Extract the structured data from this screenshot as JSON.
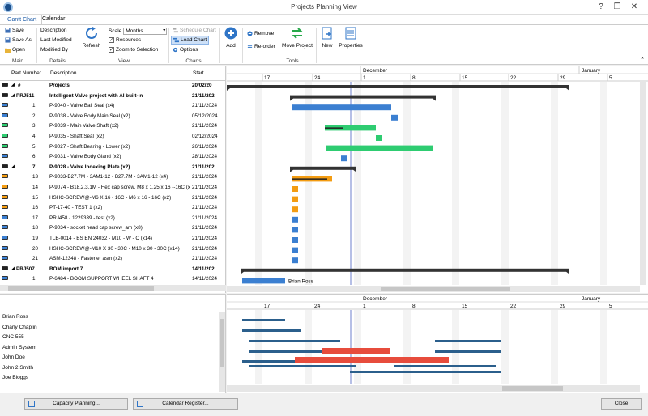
{
  "window": {
    "title": "Projects Planning View",
    "help": "?",
    "restore": "❐",
    "close": "✕"
  },
  "tabs": [
    {
      "label": "Gantt Chart"
    },
    {
      "label": "Calendar"
    }
  ],
  "ribbon": {
    "main": {
      "save": "Save",
      "save_as": "Save As",
      "open": "Open",
      "label": "Main"
    },
    "details": {
      "description": "Description",
      "last_modified": "Last Modified",
      "modified_by": "Modified By",
      "label": "Details"
    },
    "view": {
      "refresh": "Refresh",
      "scale_label": "Scale",
      "scale_value": "Months",
      "resources": "Resources",
      "zoom_to_selection": "Zoom to Selection",
      "label": "View"
    },
    "charts": {
      "schedule_chart": "Schedule Chart",
      "load_chart": "Load Chart",
      "options": "Options",
      "label": "Charts"
    },
    "tools": {
      "add": "Add",
      "remove": "Remove",
      "reorder": "Re-order",
      "move_project": "Move Project",
      "new": "New",
      "properties": "Properties",
      "label": "Tools"
    }
  },
  "grid": {
    "headers": {
      "part_number": "Part Number",
      "description": "Description",
      "start": "Start"
    },
    "rows": [
      {
        "num": "#",
        "desc": "Projects",
        "start": "20/02/20",
        "bold": true,
        "expander": "◢",
        "color": "#222"
      },
      {
        "num": "PRJ511",
        "desc": "Intelligent Valve project with AI built-in",
        "start": "21/11/202",
        "bold": true,
        "expander": "◢",
        "color": "#222"
      },
      {
        "num": "1",
        "desc": "P-9040  - Valve Ball Seal  (x4)",
        "start": "21/11/2024",
        "bold": false,
        "expander": "",
        "color": "#3b7fd1"
      },
      {
        "num": "2",
        "desc": "P-9038  - Valve Body Main Seal  (x2)",
        "start": "05/12/2024",
        "bold": false,
        "expander": "",
        "color": "#3b7fd1"
      },
      {
        "num": "3",
        "desc": "P-9039  - Main Valve Shaft  (x2)",
        "start": "21/11/2024",
        "bold": false,
        "expander": "",
        "color": "#2ecc71"
      },
      {
        "num": "4",
        "desc": "P-9035  - Shaft Seal  (x2)",
        "start": "02/12/2024",
        "bold": false,
        "expander": "",
        "color": "#2ecc71"
      },
      {
        "num": "5",
        "desc": "P-9027  - Shaft Bearing - Lower  (x2)",
        "start": "26/11/2024",
        "bold": false,
        "expander": "",
        "color": "#2ecc71"
      },
      {
        "num": "6",
        "desc": "P-9031  - Valve Body Gland  (x2)",
        "start": "28/11/2024",
        "bold": false,
        "expander": "",
        "color": "#3b7fd1"
      },
      {
        "num": "7",
        "desc": "P-9028  - Valve Indexing Plate  (x2)",
        "start": "21/11/202",
        "bold": true,
        "expander": "◢",
        "color": "#222"
      },
      {
        "num": "13",
        "desc": "P-9033-B27.7M - 3AM1-12  - B27.7M - 3AM1-12  (x4)",
        "start": "21/11/2024",
        "bold": false,
        "expander": "",
        "color": "#f39c12"
      },
      {
        "num": "14",
        "desc": "P-9074  - B18.2.3.1M - Hex cap screw, M8 x 1.25 x 16 --16C  (x4)",
        "start": "21/11/2024",
        "bold": false,
        "expander": "",
        "color": "#f39c12"
      },
      {
        "num": "15",
        "desc": "HSHC-SCREW@-M6 X 16 - 16C  - M6 x 16 - 16C  (x2)",
        "start": "21/11/2024",
        "bold": false,
        "expander": "",
        "color": "#f39c12"
      },
      {
        "num": "16",
        "desc": "PT-17-40  - TEST 1  (x2)",
        "start": "21/11/2024",
        "bold": false,
        "expander": "",
        "color": "#f39c12"
      },
      {
        "num": "17",
        "desc": "PRJ458  - 1229339 - test  (x2)",
        "start": "21/11/2024",
        "bold": false,
        "expander": "",
        "color": "#3b7fd1"
      },
      {
        "num": "18",
        "desc": "P-9034  - socket head cap screw_am  (x8)",
        "start": "21/11/2024",
        "bold": false,
        "expander": "",
        "color": "#3b7fd1"
      },
      {
        "num": "19",
        "desc": "TLB-0014  - BS EN 24032 - M10 - W - C  (x14)",
        "start": "21/11/2024",
        "bold": false,
        "expander": "",
        "color": "#3b7fd1"
      },
      {
        "num": "20",
        "desc": "HSHC-SCREW@-M10 X 30 - 30C  - M10 x 30 - 30C  (x14)",
        "start": "21/11/2024",
        "bold": false,
        "expander": "",
        "color": "#3b7fd1"
      },
      {
        "num": "21",
        "desc": "ASM-12348  - Fastener asm  (x2)",
        "start": "21/11/2024",
        "bold": false,
        "expander": "",
        "color": "#3b7fd1"
      },
      {
        "num": "PRJ507",
        "desc": "BOM import 7",
        "start": "14/11/202",
        "bold": true,
        "expander": "◢",
        "color": "#222"
      },
      {
        "num": "1",
        "desc": "P-6484  - BOOM SUPPORT WHEEL SHAFT 4",
        "start": "14/11/2024",
        "bold": false,
        "expander": "",
        "color": "#3b7fd1"
      }
    ]
  },
  "timeline": {
    "months": [
      "December",
      "January"
    ],
    "days": [
      "17",
      "24",
      "1",
      "8",
      "15",
      "22",
      "29",
      "5"
    ],
    "bar_label": "Brian Ross"
  },
  "resources": [
    "Brian Ross",
    "Charly Chaplin",
    "CNC 555",
    "Admin System",
    "John Doe",
    "John 2 Smith",
    "Joe Bloggs"
  ],
  "footer": {
    "capacity_planning": "Capacity Planning...",
    "calendar_register": "Calendar Register...",
    "close": "Close"
  },
  "colors": {
    "accent": "#1c5aa6",
    "blue_bar": "#3b7fd1",
    "green_bar": "#2ecc71",
    "orange_bar": "#f39c12",
    "summary_bar": "#333333",
    "load_bar": "#2b5f8c",
    "overload_bar": "#e74c3c"
  }
}
